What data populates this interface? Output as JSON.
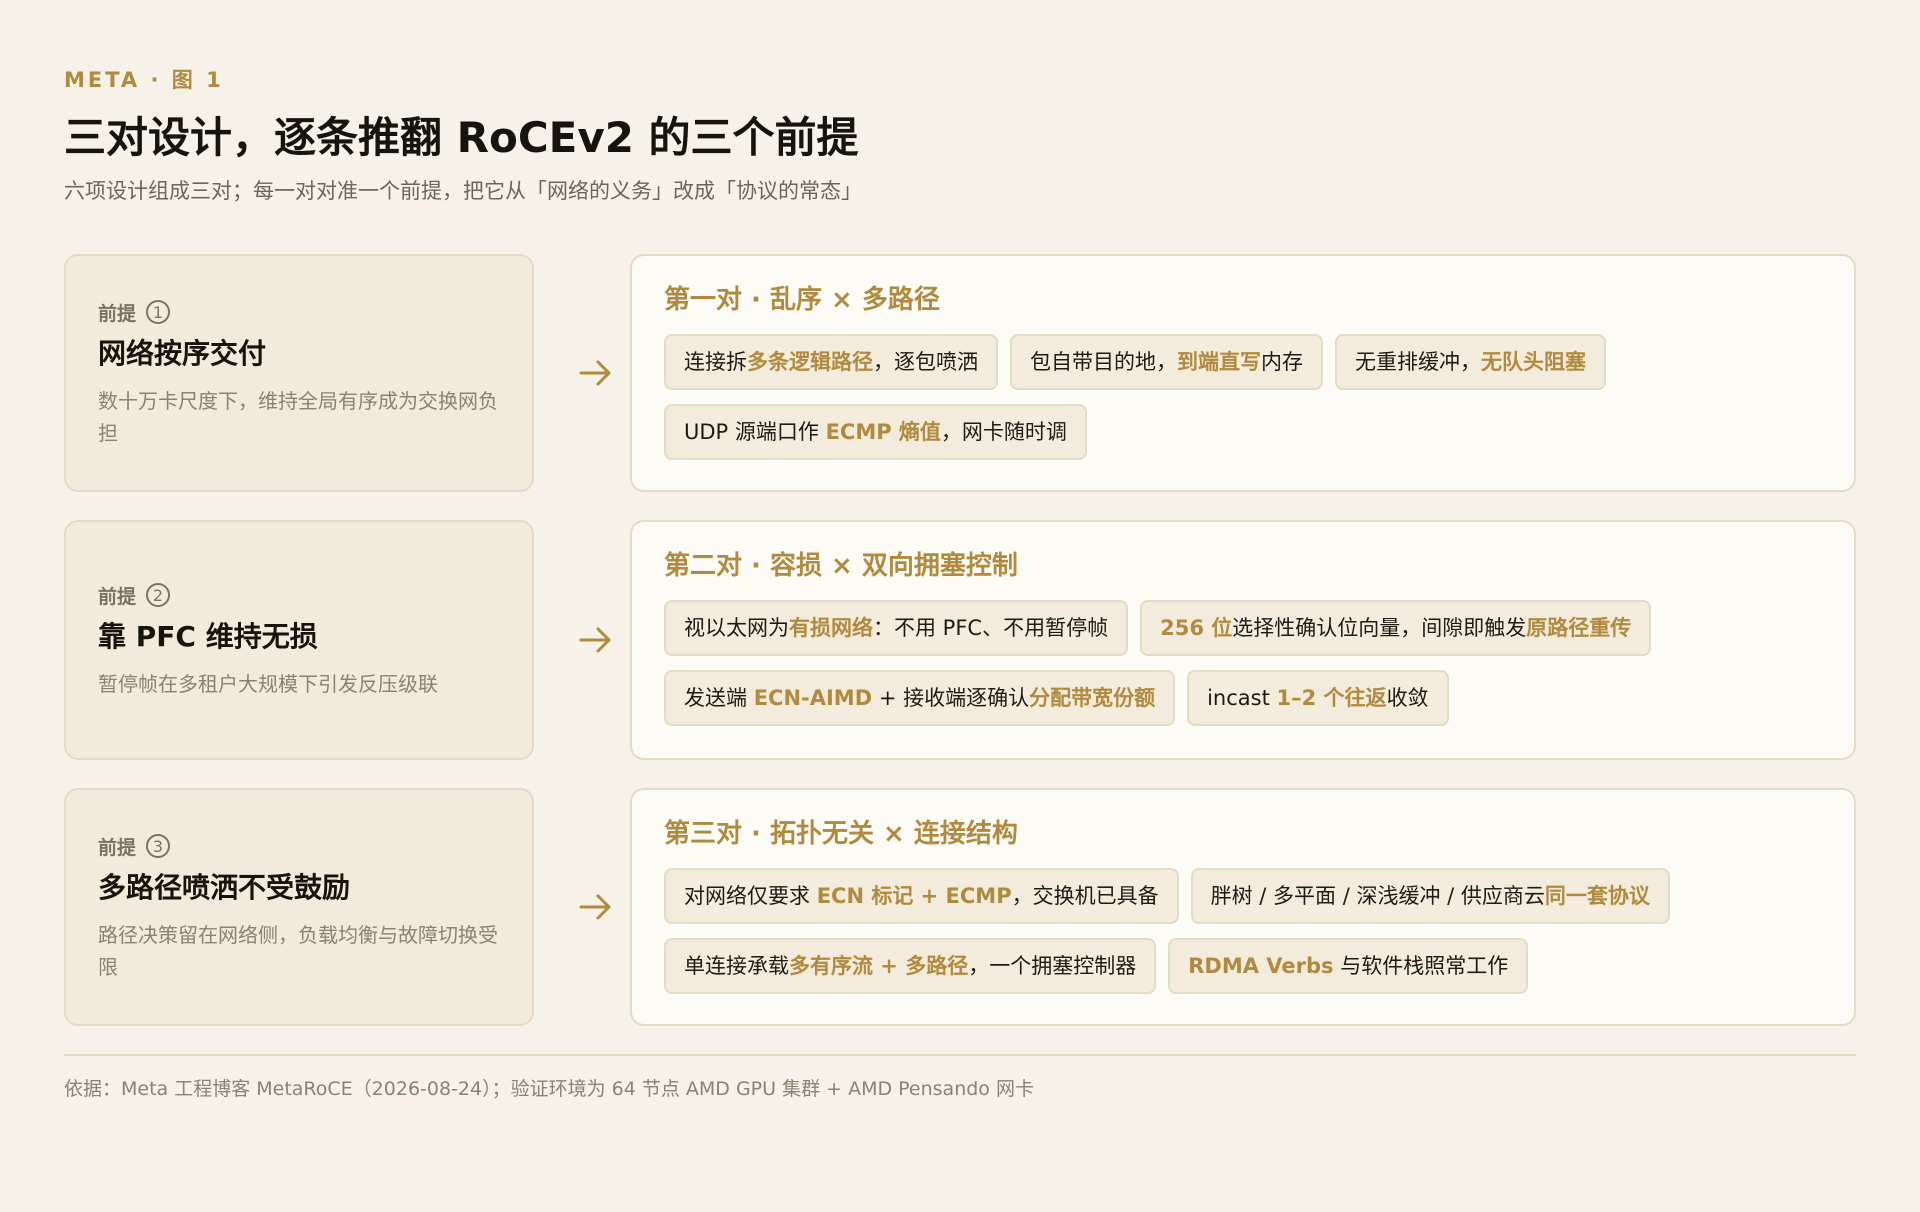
{
  "eyebrow": "META · 图 1",
  "title": "三对设计，逐条推翻 RoCEv2 的三个前提",
  "subtitle": "六项设计组成三对；每一对对准一个前提，把它从「网络的义务」改成「协议的常态」",
  "arrow_glyph": "→",
  "colors": {
    "accent": "#b08a3e",
    "background": "#f6f2e9",
    "premise_card": "#f2ebdb",
    "design_card": "#fdfbf6",
    "chip": "#f3ecdd",
    "border": "#e4dac5"
  },
  "rows": [
    {
      "premise": {
        "label": "前提",
        "num": "1",
        "title": "网络按序交付",
        "desc": "数十万卡尺度下，维持全局有序成为交换网负担"
      },
      "design": {
        "title": "第一对 · 乱序 × 多路径",
        "chips": [
          [
            {
              "t": "连接拆"
            },
            {
              "t": "多条逻辑路径",
              "h": true
            },
            {
              "t": "，逐包喷洒"
            }
          ],
          [
            {
              "t": "包自带目的地，"
            },
            {
              "t": "到端直写",
              "h": true
            },
            {
              "t": "内存"
            }
          ],
          [
            {
              "t": "无重排缓冲，"
            },
            {
              "t": "无队头阻塞",
              "h": true
            }
          ],
          [
            {
              "t": "UDP 源端口作 "
            },
            {
              "t": "ECMP 熵值",
              "h": true
            },
            {
              "t": "，网卡随时调"
            }
          ]
        ]
      }
    },
    {
      "premise": {
        "label": "前提",
        "num": "2",
        "title": "靠 PFC 维持无损",
        "desc": "暂停帧在多租户大规模下引发反压级联"
      },
      "design": {
        "title": "第二对 · 容损 × 双向拥塞控制",
        "chips": [
          [
            {
              "t": "视以太网为"
            },
            {
              "t": "有损网络",
              "h": true
            },
            {
              "t": "：不用 PFC、不用暂停帧"
            }
          ],
          [
            {
              "t": "256 位",
              "h": true
            },
            {
              "t": "选择性确认位向量，间隙即触发"
            },
            {
              "t": "原路径重传",
              "h": true
            }
          ],
          [
            {
              "t": "发送端 "
            },
            {
              "t": "ECN-AIMD",
              "h": true
            },
            {
              "t": " + 接收端逐确认"
            },
            {
              "t": "分配带宽份额",
              "h": true
            }
          ],
          [
            {
              "t": "incast "
            },
            {
              "t": "1–2 个往返",
              "h": true
            },
            {
              "t": "收敛"
            }
          ]
        ]
      }
    },
    {
      "premise": {
        "label": "前提",
        "num": "3",
        "title": "多路径喷洒不受鼓励",
        "desc": "路径决策留在网络侧，负载均衡与故障切换受限"
      },
      "design": {
        "title": "第三对 · 拓扑无关 × 连接结构",
        "chips": [
          [
            {
              "t": "对网络仅要求 "
            },
            {
              "t": "ECN 标记 + ECMP",
              "h": true
            },
            {
              "t": "，交换机已具备"
            }
          ],
          [
            {
              "t": "胖树 / 多平面 / 深浅缓冲 / 供应商云"
            },
            {
              "t": "同一套协议",
              "h": true
            }
          ],
          [
            {
              "t": "单连接承载"
            },
            {
              "t": "多有序流 + 多路径",
              "h": true
            },
            {
              "t": "，一个拥塞控制器"
            }
          ],
          [
            {
              "t": "RDMA Verbs",
              "h": true
            },
            {
              "t": " 与软件栈照常工作"
            }
          ]
        ]
      }
    }
  ],
  "footnote": "依据：Meta 工程博客 MetaRoCE（2026-08-24）；验证环境为 64 节点 AMD GPU 集群 + AMD Pensando 网卡"
}
